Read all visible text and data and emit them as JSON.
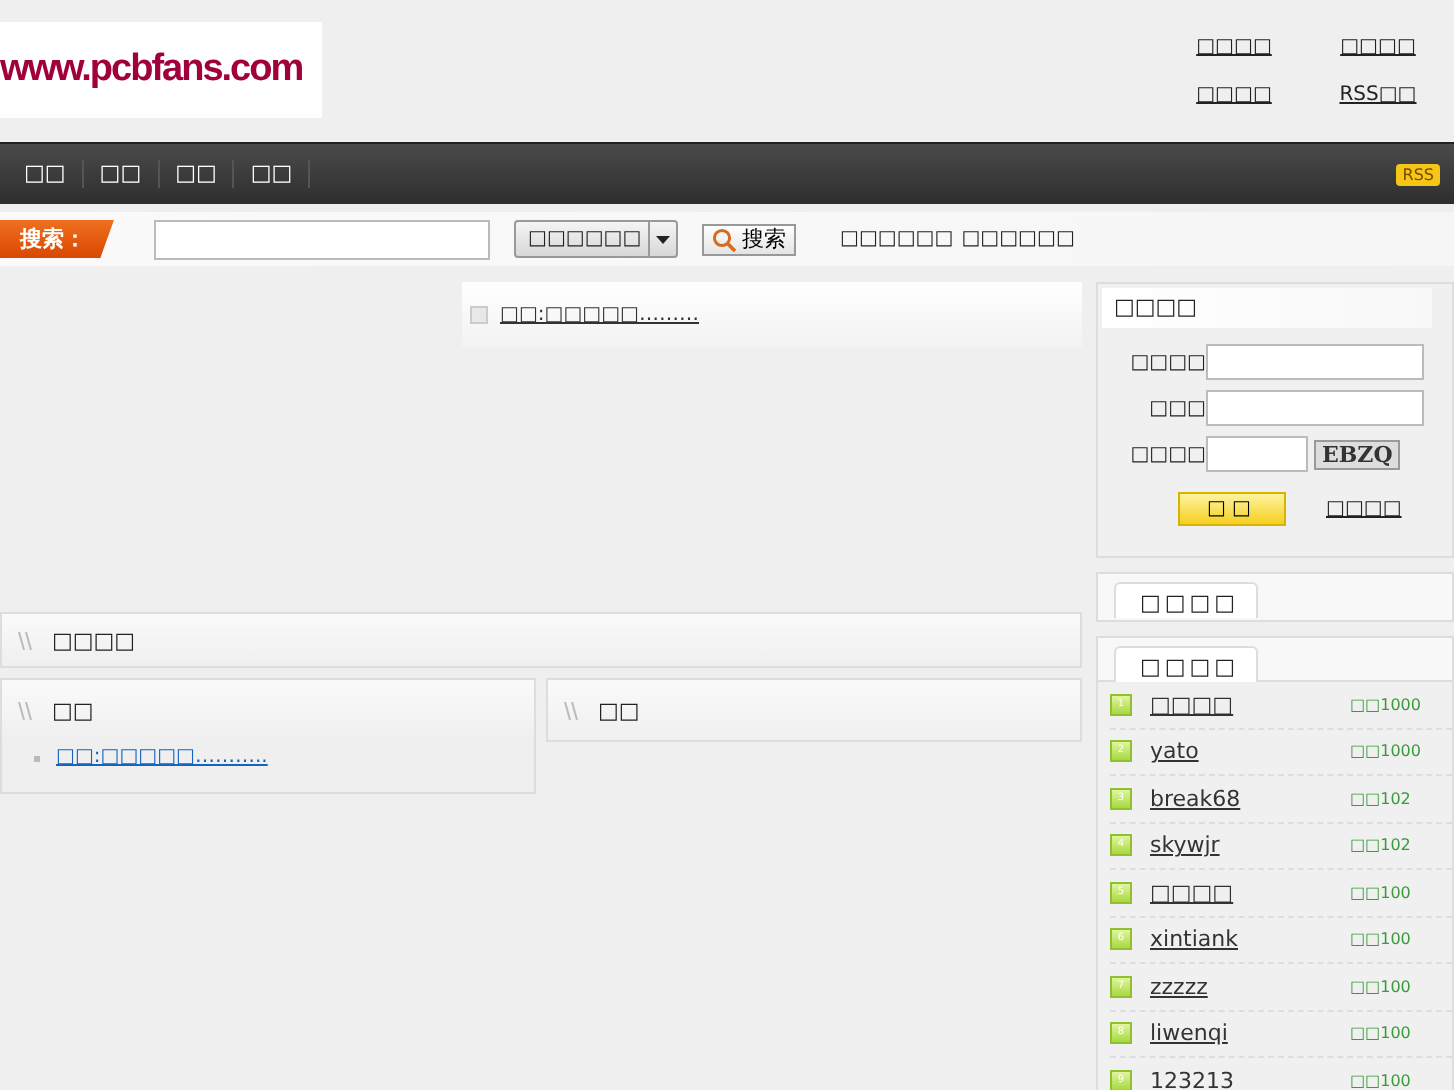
{
  "header": {
    "logo": "www.pcbfans.com",
    "links": [
      "□□□□",
      "□□□□",
      "□□□□",
      "RSS□□"
    ]
  },
  "nav": {
    "items": [
      "□□",
      "□□",
      "□□",
      "□□"
    ],
    "badge": "RSS"
  },
  "search": {
    "label": "搜索：",
    "scope": "□□□□□□",
    "button": "搜索",
    "hints": [
      "□□□□□□",
      "□□□□□□"
    ]
  },
  "notice": {
    "link": "□□:□□□□□………"
  },
  "section": {
    "title": "□□□□"
  },
  "columns": [
    {
      "title": "□□",
      "items": [
        "□□:□□□□□……….."
      ]
    },
    {
      "title": "□□"
    }
  ],
  "login": {
    "title": "□□□□",
    "fields": [
      {
        "label": "□□□□",
        "kind": "text"
      },
      {
        "label": "□□□",
        "kind": "password"
      },
      {
        "label": "□□□□",
        "kind": "captcha",
        "captcha": "EBZQ"
      }
    ],
    "submit": "□□",
    "link": "□□□□"
  },
  "panel": {
    "tab": "□□□□"
  },
  "ranking": {
    "tab": "□□□□",
    "rows": [
      {
        "rank": "1",
        "name": "□□□□",
        "points": "□□1000"
      },
      {
        "rank": "2",
        "name": "yato",
        "points": "□□1000"
      },
      {
        "rank": "3",
        "name": "break68",
        "points": "□□102"
      },
      {
        "rank": "4",
        "name": "skywjr",
        "points": "□□102"
      },
      {
        "rank": "5",
        "name": "□□□□",
        "points": "□□100"
      },
      {
        "rank": "6",
        "name": "xintiank",
        "points": "□□100"
      },
      {
        "rank": "7",
        "name": "zzzzz",
        "points": "□□100"
      },
      {
        "rank": "8",
        "name": "liwenqi",
        "points": "□□100"
      },
      {
        "rank": "9",
        "name": "123213",
        "points": "□□100"
      }
    ]
  }
}
